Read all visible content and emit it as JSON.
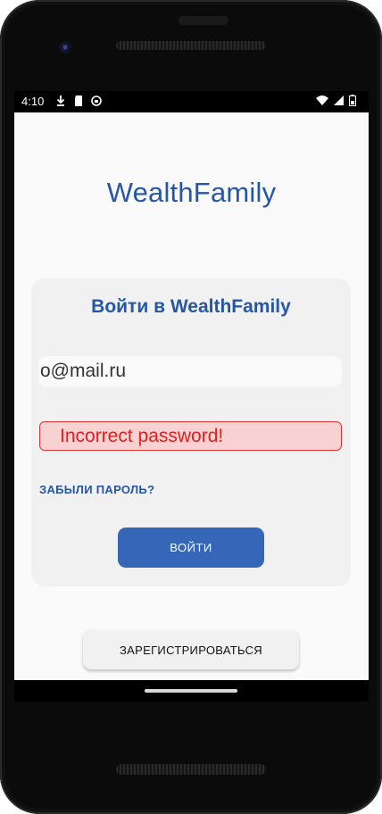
{
  "status_bar": {
    "time": "4:10",
    "left_icons": [
      "download-icon",
      "sd-card-icon",
      "sync-icon"
    ],
    "right_icons": [
      "wifi-icon",
      "signal-icon",
      "battery-icon"
    ]
  },
  "app": {
    "title": "WealthFamily",
    "login_card": {
      "title": "Войти в WealthFamily",
      "email_value": "o@mail.ru",
      "error_message": "Incorrect password!",
      "forgot_password_label": "ЗАБЫЛИ ПАРОЛЬ?",
      "login_button_label": "ВОЙТИ"
    },
    "register_button_label": "ЗАРЕГИСТРИРОВАТЬСЯ"
  },
  "colors": {
    "brand_blue": "#2557a4",
    "button_blue": "#3566b7",
    "error_red": "#e02020",
    "error_bg": "#f8d2d2"
  }
}
